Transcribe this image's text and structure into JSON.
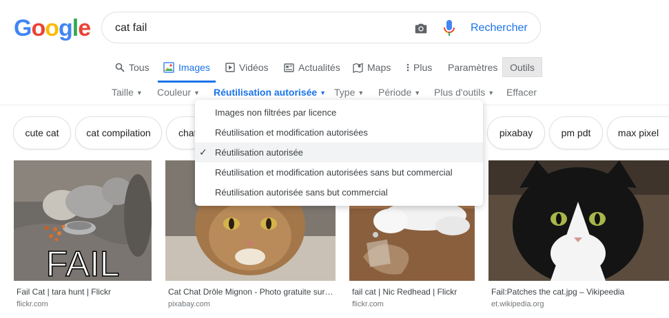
{
  "logo": {
    "letters": [
      "G",
      "o",
      "o",
      "g",
      "l",
      "e"
    ]
  },
  "colors": {
    "blue": "#4285F4",
    "red": "#EA4335",
    "yellow": "#FBBC05",
    "green": "#34A853",
    "accent": "#1a73e8"
  },
  "search": {
    "query": "cat fail",
    "button_label": "Rechercher",
    "camera_icon": "camera-icon",
    "mic_icon": "mic-icon"
  },
  "tabs": [
    {
      "label": "Tous",
      "icon": "search-icon"
    },
    {
      "label": "Images",
      "icon": "images-icon",
      "active": true
    },
    {
      "label": "Vidéos",
      "icon": "play-icon"
    },
    {
      "label": "Actualités",
      "icon": "news-icon"
    },
    {
      "label": "Maps",
      "icon": "map-icon"
    },
    {
      "label": "Plus",
      "icon": "more-vert-icon"
    },
    {
      "label": "Paramètres"
    },
    {
      "label": "Outils"
    }
  ],
  "filters": [
    {
      "label": "Taille"
    },
    {
      "label": "Couleur"
    },
    {
      "label": "Réutilisation autorisée",
      "selected": true
    },
    {
      "label": "Type"
    },
    {
      "label": "Période"
    },
    {
      "label": "Plus d'outils"
    },
    {
      "label": "Effacer"
    }
  ],
  "chips": [
    "cute cat",
    "cat compilation",
    "chat",
    "pixabay",
    "pm pdt",
    "max pixel"
  ],
  "dropdown": {
    "items": [
      {
        "label": "Images non filtrées par licence",
        "checked": false
      },
      {
        "label": "Réutilisation et modification autorisées",
        "checked": false
      },
      {
        "label": "Réutilisation autorisée",
        "checked": true
      },
      {
        "label": "Réutilisation et modification autorisées sans but commercial",
        "checked": false
      },
      {
        "label": "Réutilisation autorisée sans but commercial",
        "checked": false
      }
    ],
    "check_symbol": "✓"
  },
  "results": [
    {
      "title": "Fail Cat | tara hunt | Flickr",
      "site": "flickr.com",
      "overlay_text": "FAIL"
    },
    {
      "title": "Cat Chat Drôle Mignon - Photo gratuite sur ...",
      "site": "pixabay.com"
    },
    {
      "title": "fail cat | Nic Redhead | Flickr",
      "site": "flickr.com"
    },
    {
      "title": "Fail:Patches the cat.jpg – Vikipeedia",
      "site": "et.wikipedia.org"
    }
  ]
}
